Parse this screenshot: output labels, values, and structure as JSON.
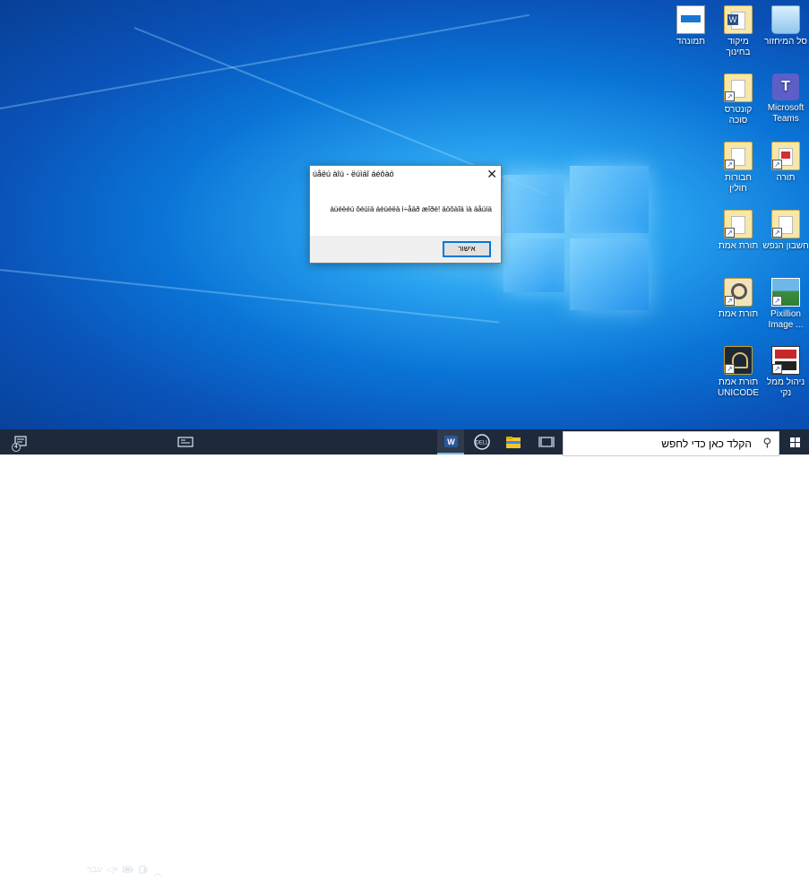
{
  "desktop": {
    "icons": [
      {
        "label": "סל המיחזור",
        "icon": "recycle-bin-icon"
      },
      {
        "label": "מיקוד בחינוך",
        "icon": "word-document-icon"
      },
      {
        "label": "תמונהד",
        "icon": "image-file-icon"
      },
      {
        "label": "Microsoft Teams",
        "icon": "teams-icon"
      },
      {
        "label": "קונטרס סוכה",
        "icon": "folder-shortcut-icon"
      },
      {
        "label": "תורה",
        "icon": "folder-shortcut-icon"
      },
      {
        "label": "חבורות חולין",
        "icon": "folder-shortcut-icon"
      },
      {
        "label": "חשבון הנפש",
        "icon": "folder-shortcut-icon"
      },
      {
        "label": "תורת אמת",
        "icon": "folder-shortcut-icon"
      },
      {
        "label": "Pixillion Image ...",
        "icon": "pixillion-icon"
      },
      {
        "label": "תורת אמת",
        "icon": "magnifier-app-icon"
      },
      {
        "label": "ניהול ממל נקי",
        "icon": "app-logo-icon"
      },
      {
        "label": "תורת אמת UNICODE",
        "icon": "unicode-app-icon"
      }
    ]
  },
  "dialog": {
    "title": "úåëú àîú - ëúìáî áéôàö",
    "message": "àùéëéú ôéúìä áèùéëä ì÷åäð æîðé! äöôàîä ìà äåùìä",
    "ok_label": "אישור",
    "close_glyph": "✕"
  },
  "taskbar": {
    "search_placeholder": "הקלד כאן כדי לחפש",
    "language": "עבר",
    "time": "02:06",
    "date": "14/08/2025",
    "notification_count": "4",
    "pinned_apps": [
      "word-icon",
      "dell-icon",
      "file-explorer-icon",
      "task-view-icon"
    ]
  },
  "colors": {
    "taskbar_bg": "#1e2a3b",
    "accent": "#0078d7",
    "desktop_blue": "#0a74d6"
  }
}
